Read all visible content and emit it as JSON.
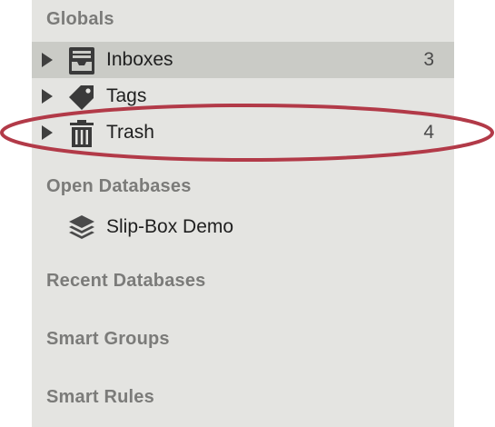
{
  "sidebar": {
    "globals_title": "Globals",
    "items": [
      {
        "label": "Inboxes",
        "count": "3",
        "icon": "inbox-icon"
      },
      {
        "label": "Tags",
        "count": "",
        "icon": "tag-icon"
      },
      {
        "label": "Trash",
        "count": "4",
        "icon": "trash-icon"
      }
    ],
    "open_databases_title": "Open Databases",
    "databases": [
      {
        "label": "Slip-Box Demo",
        "icon": "database-stack-icon"
      }
    ],
    "recent_databases_title": "Recent Databases",
    "smart_groups_title": "Smart Groups",
    "smart_rules_title": "Smart Rules"
  },
  "colors": {
    "sidebar_bg": "#e4e4e1",
    "selected_row_bg": "#cacbc6",
    "annotation_ellipse": "#b23a48"
  }
}
